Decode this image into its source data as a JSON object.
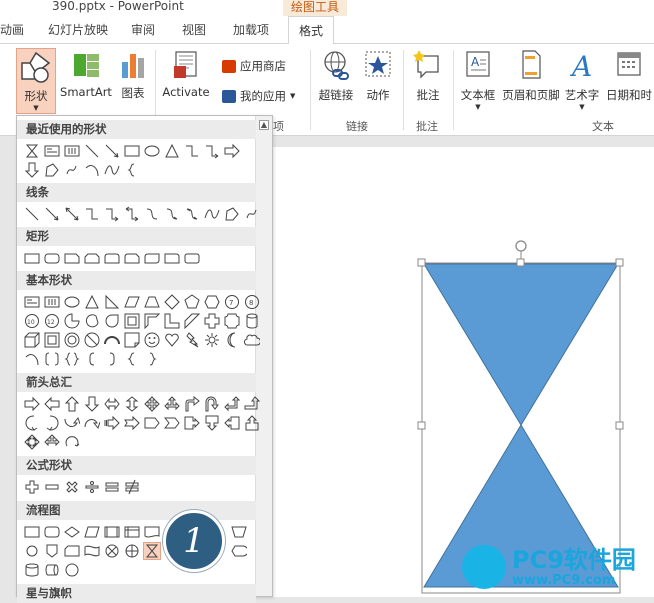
{
  "window": {
    "file_title": "390.pptx - PowerPoint",
    "context_header": "绘图工具"
  },
  "tabs": [
    {
      "label": "动画"
    },
    {
      "label": "幻灯片放映"
    },
    {
      "label": "审阅"
    },
    {
      "label": "视图"
    },
    {
      "label": "加载项"
    },
    {
      "label": "格式"
    }
  ],
  "ribbon": {
    "shapes_label": "形状",
    "smartart_label": "SmartArt",
    "chart_label": "图表",
    "activate_label": "Activate",
    "app_store_label": "应用商店",
    "my_apps_label": "我的应用",
    "hyperlink_label": "超链接",
    "action_label": "动作",
    "comment_label": "批注",
    "textbox_label": "文本框",
    "header_footer_label": "页眉和页脚",
    "wordart_label": "艺术字",
    "datetime_label": "日期和时",
    "group_apps_fragment": "项",
    "group_links": "链接",
    "group_comments": "批注",
    "group_text": "文本"
  },
  "shapes_panel": {
    "categories": [
      {
        "label": "最近使用的形状"
      },
      {
        "label": "线条"
      },
      {
        "label": "矩形"
      },
      {
        "label": "基本形状"
      },
      {
        "label": "箭头总汇"
      },
      {
        "label": "公式形状"
      },
      {
        "label": "流程图"
      },
      {
        "label": "星与旗帜"
      }
    ]
  },
  "badge": {
    "text": "1"
  },
  "watermark": {
    "brand": "PC9软件园",
    "url": "www.PC9.com"
  },
  "colors": {
    "accent": "#5b9bd5",
    "selected_bg": "#f8d1bf",
    "context": "#c55a11"
  }
}
